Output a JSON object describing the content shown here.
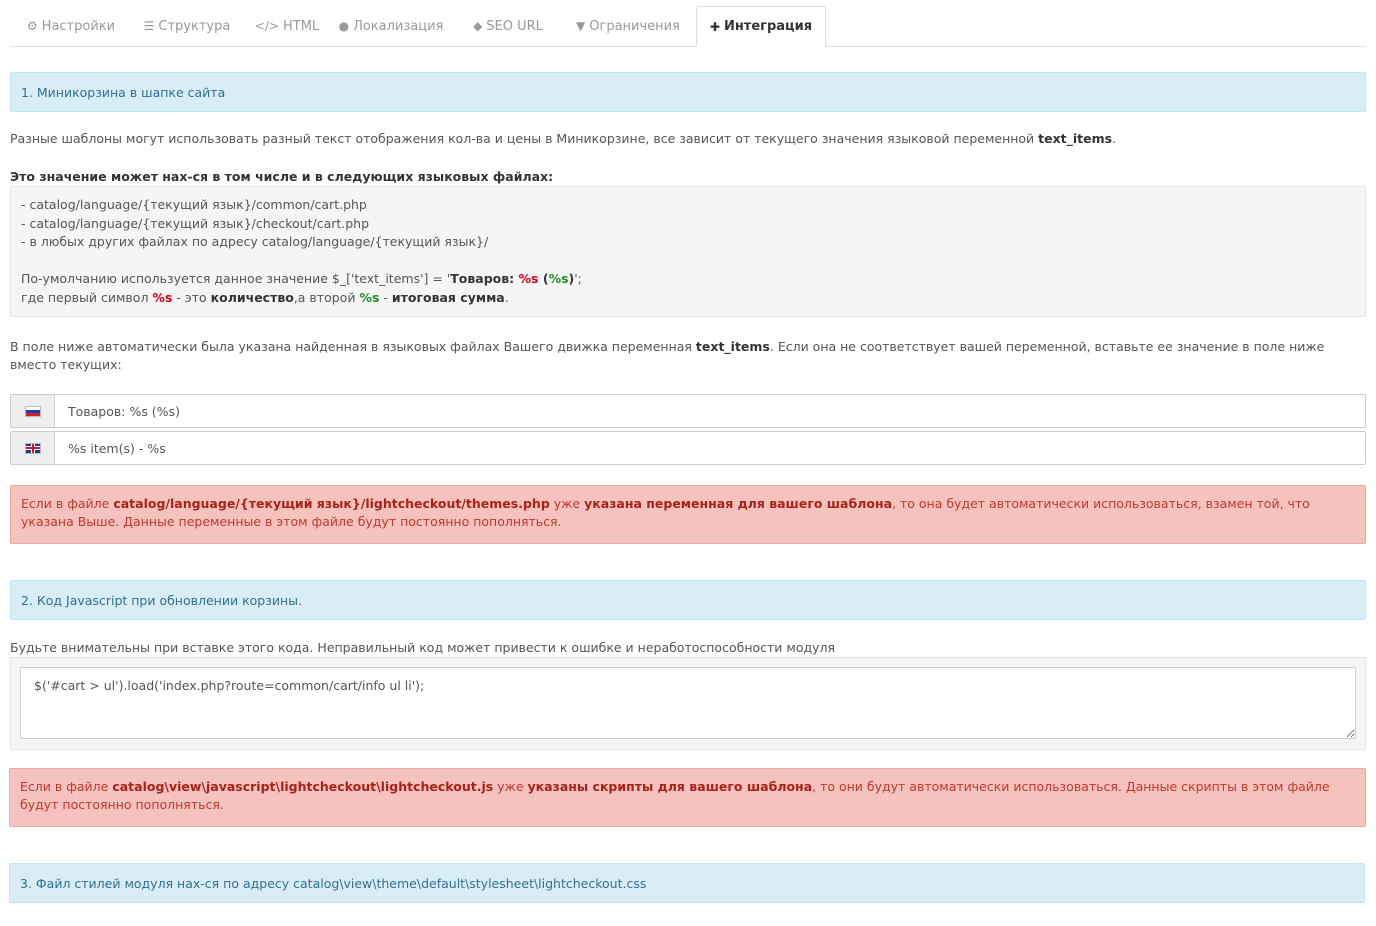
{
  "tabs": [
    {
      "label": "Настройки",
      "icon": "⚙"
    },
    {
      "label": "Структура",
      "icon": "☰"
    },
    {
      "label": "HTML",
      "icon": "</>"
    },
    {
      "label": "Локализация",
      "icon": "●"
    },
    {
      "label": "SEO URL",
      "icon": "◆"
    },
    {
      "label": "Ограничения",
      "icon": "▼"
    },
    {
      "label": "Интеграция",
      "icon": "✚"
    }
  ],
  "section1": {
    "heading": "1. Миникорзина в шапке сайта",
    "intro_pre": "Разные шаблоны могут использовать разный текст отображения кол-ва и цены в Миникорзине, все зависит от текущего значения языковой переменной ",
    "intro_var": "text_items",
    "intro_post": ".",
    "files_title": "Это значение может нах-ся в том числе и в следующих языковых файлах:",
    "file1": "- catalog/language/{текущий язык}/common/cart.php",
    "file2": "- catalog/language/{текущий язык}/checkout/cart.php",
    "file3": "- в любых других файлах по адресу catalog/language/{текущий язык}/",
    "default_pre": "По-умолчанию используется данное значение $_['text_items'] = '",
    "default_word": "Товаров: ",
    "default_s1": "%s",
    "default_mid": " (",
    "default_s2": "%s",
    "default_close": ")",
    "default_post": "';",
    "where_pre": "где первый символ ",
    "where_s1": "%s",
    "where_mid1": " - это ",
    "where_qty": "количество",
    "where_mid2": ",а второй ",
    "where_s2": "%s",
    "where_mid3": " - ",
    "where_total": "итоговая сумма",
    "where_end": ".",
    "auto_pre": "В поле ниже автоматически была указана найденная в языковых файлах Вашего движка переменная ",
    "auto_var": "text_items",
    "auto_post": ". Если она не соответствует вашей переменной, вставьте ее значение в поле ниже вместо текущих:",
    "input_ru": "Товаров: %s (%s)",
    "input_en": "%s item(s) - %s",
    "alert_pre": "Если в файле ",
    "alert_file": "catalog/language/{текущий язык}/lightcheckout/themes.php",
    "alert_mid": " уже ",
    "alert_bold": "указана переменная для вашего шаблона",
    "alert_post": ", то она будет автоматически использоваться, взамен той, что указана Выше. Данные переменные в этом файле будут постоянно пополняться."
  },
  "section2": {
    "heading": "2. Код Javascript при обновлении корзины.",
    "warning": "Будьте внимательны при вставке этого кода. Неправильный код может привести к ошибке и неработоспособности модуля",
    "code": "$('#cart > ul').load('index.php?route=common/cart/info ul li');",
    "alert_pre": "Если в файле ",
    "alert_file": "catalog\\view\\javascript\\lightcheckout\\lightcheckout.js",
    "alert_mid": " уже ",
    "alert_bold": "указаны скрипты для вашего шаблона",
    "alert_post": ", то они будут автоматически использоваться. Данные скрипты в этом файле будут постоянно пополняться."
  },
  "section3": {
    "heading": "3. Файл стилей модуля нах-ся по адресу catalog\\view\\theme\\default\\stylesheet\\lightcheckout.css"
  },
  "colors": {
    "info_bg": "#d9edf7",
    "danger_bg": "#f5c2be",
    "accent_red": "#d9001b",
    "accent_green": "#1f8f1f"
  }
}
